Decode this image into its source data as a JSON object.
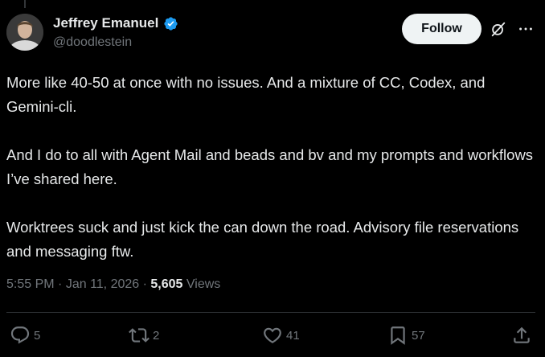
{
  "author": {
    "display_name": "Jeffrey Emanuel",
    "handle": "@doodlestein",
    "verified": true
  },
  "header": {
    "follow_label": "Follow",
    "icons": [
      "grok-icon",
      "more-icon"
    ]
  },
  "tweet": {
    "paragraphs": [
      "More like 40-50 at once with no issues. And a mixture of CC, Codex, and Gemini-cli.",
      "And I do to all with Agent Mail and beads and bv and my prompts and workflows I’ve shared here.",
      "Worktrees suck and just kick the can down the road. Advisory file reservations and messaging ftw."
    ]
  },
  "meta": {
    "time": "5:55 PM",
    "separator": "·",
    "date": "Jan 11, 2026",
    "views_count": "5,605",
    "views_label": "Views"
  },
  "actions": {
    "replies": "5",
    "reposts": "2",
    "likes": "41",
    "bookmarks": "57"
  },
  "colors": {
    "background": "#000000",
    "text_primary": "#e7e9ea",
    "text_secondary": "#71767b",
    "verified_badge": "#1d9bf0",
    "follow_button_bg": "#eff3f4",
    "divider": "#2f3336"
  }
}
